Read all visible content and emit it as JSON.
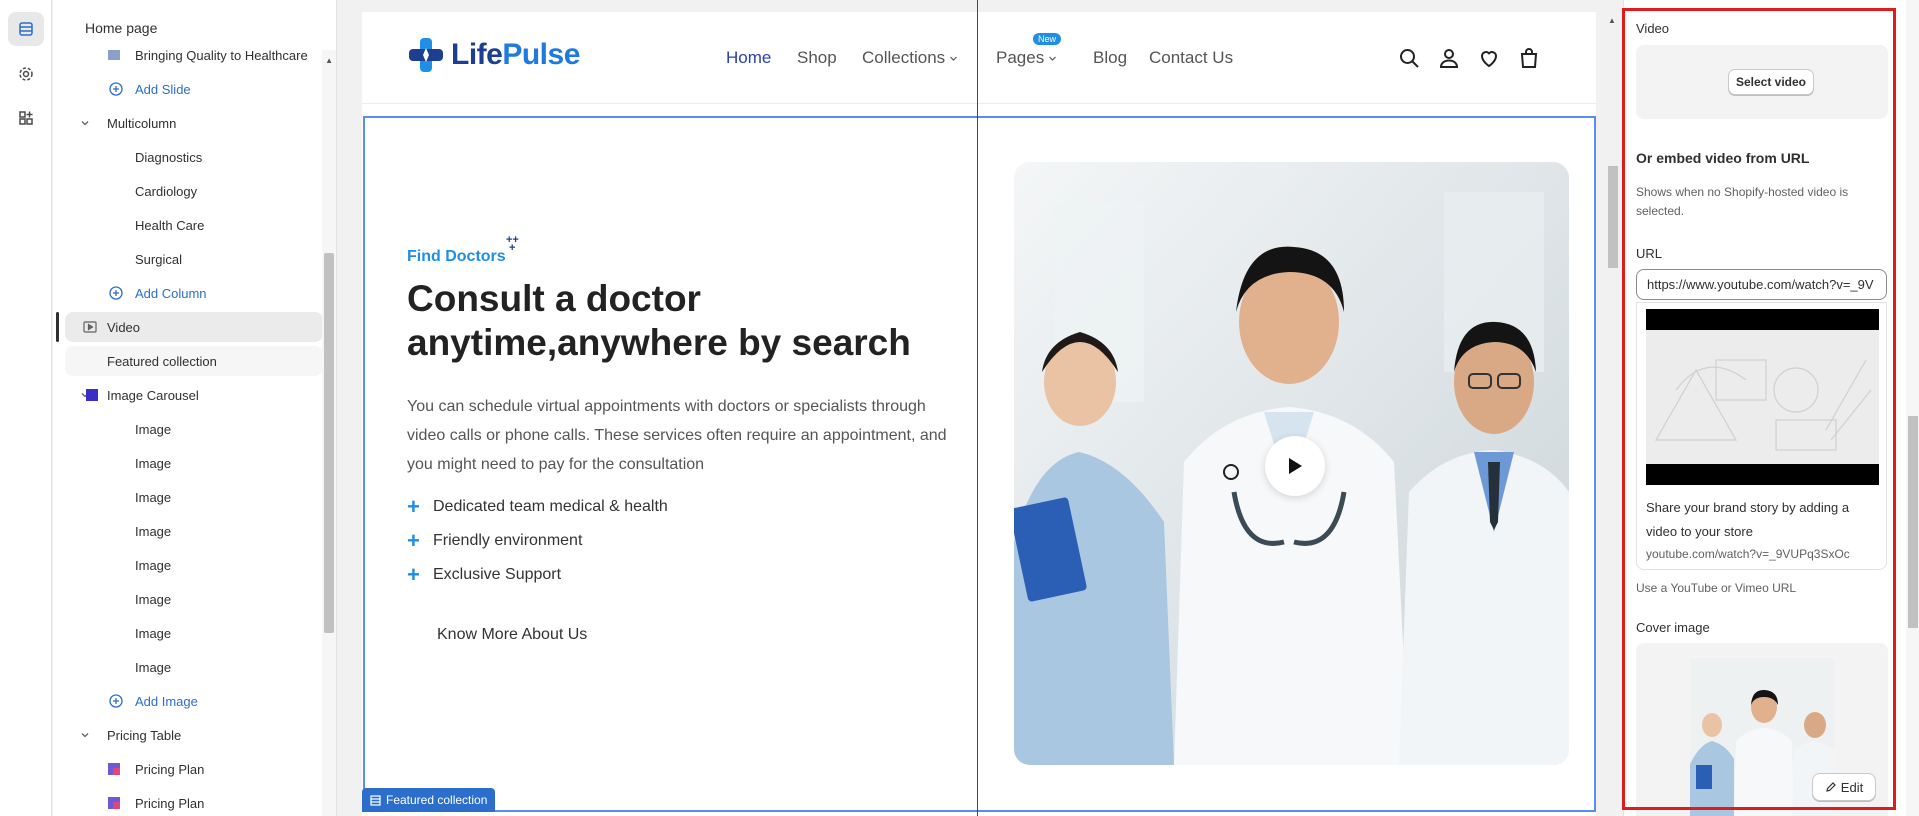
{
  "rail": {
    "items": [
      {
        "name": "sections-icon"
      },
      {
        "name": "settings-icon"
      },
      {
        "name": "apps-icon"
      }
    ]
  },
  "sidebar": {
    "title": "Home page",
    "items": [
      {
        "label": "Bringing Quality to Healthcare",
        "kind": "block"
      },
      {
        "label": "Add Slide",
        "kind": "add"
      },
      {
        "label": "Multicolumn",
        "kind": "section"
      },
      {
        "label": "Diagnostics",
        "kind": "child"
      },
      {
        "label": "Cardiology",
        "kind": "child"
      },
      {
        "label": "Health Care",
        "kind": "child"
      },
      {
        "label": "Surgical",
        "kind": "child"
      },
      {
        "label": "Add Column",
        "kind": "add"
      },
      {
        "label": "Video",
        "kind": "section-selected"
      },
      {
        "label": "Featured collection",
        "kind": "section-hover"
      },
      {
        "label": "Image Carousel",
        "kind": "section"
      },
      {
        "label": "Image",
        "kind": "child"
      },
      {
        "label": "Image",
        "kind": "child"
      },
      {
        "label": "Image",
        "kind": "child"
      },
      {
        "label": "Image",
        "kind": "child"
      },
      {
        "label": "Image",
        "kind": "child"
      },
      {
        "label": "Image",
        "kind": "child"
      },
      {
        "label": "Image",
        "kind": "child"
      },
      {
        "label": "Image",
        "kind": "child"
      },
      {
        "label": "Add Image",
        "kind": "add"
      },
      {
        "label": "Pricing Table",
        "kind": "section"
      },
      {
        "label": "Pricing Plan",
        "kind": "block"
      },
      {
        "label": "Pricing Plan",
        "kind": "block"
      }
    ]
  },
  "store": {
    "logo": {
      "part1": "Life",
      "part2": "Pulse"
    },
    "nav": [
      "Home",
      "Shop",
      "Collections",
      "Pages",
      "Blog",
      "Contact Us"
    ],
    "new_badge": "New",
    "eyebrow": "Find Doctors",
    "headline": "Consult a doctor anytime,anywhere by search",
    "paragraph": "You can schedule virtual appointments with doctors or specialists through video calls or phone calls. These services often require an appointment, and you might need to pay for the consultation",
    "bullets": [
      "Dedicated team medical & health",
      "Friendly environment",
      "Exclusive Support"
    ],
    "cta": "Know More About Us",
    "section_tag": "Featured collection"
  },
  "settings": {
    "video_label": "Video",
    "select_video": "Select video",
    "embed_title": "Or embed video from URL",
    "embed_help": "Shows when no Shopify-hosted video is selected.",
    "url_label": "URL",
    "url_value": "https://www.youtube.com/watch?v=_9V",
    "preview_title": "Share your brand story by adding a video to your store",
    "preview_url": "youtube.com/watch?v=_9VUPq3SxOc",
    "url_help": "Use a YouTube or Vimeo URL",
    "cover_label": "Cover image",
    "edit": "Edit"
  },
  "colors": {
    "accent": "#2c6ecb",
    "brand_blue": "#1f8ee6",
    "brand_navy": "#1d3f91",
    "highlight": "#e01b1b"
  }
}
